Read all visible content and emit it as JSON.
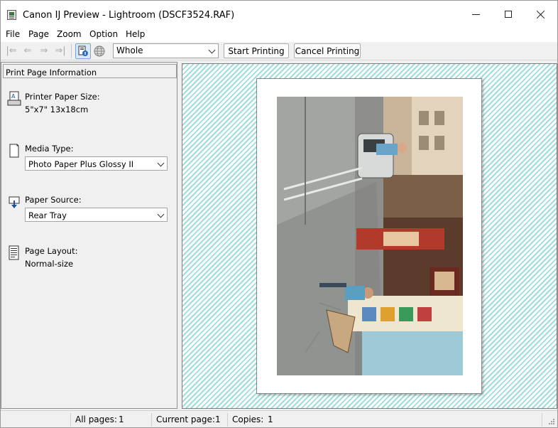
{
  "window": {
    "title": "Canon IJ Preview - Lightroom (DSCF3524.RAF)",
    "icon": "printer-app-icon"
  },
  "menu": {
    "items": [
      "File",
      "Page",
      "Zoom",
      "Option",
      "Help"
    ]
  },
  "toolbar": {
    "nav_icons": [
      "first-page-icon",
      "previous-page-icon",
      "next-page-icon",
      "last-page-icon"
    ],
    "zoom_value": "Whole",
    "start_printing": "Start Printing",
    "cancel_printing": "Cancel Printing"
  },
  "panel": {
    "header": "Print Page Information",
    "paper_size_label": "Printer Paper Size:",
    "paper_size_value": "5\"x7\" 13x18cm",
    "media_type_label": "Media Type:",
    "media_type_value": "Photo Paper Plus Glossy II",
    "paper_source_label": "Paper Source:",
    "paper_source_value": "Rear Tray",
    "page_layout_label": "Page Layout:",
    "page_layout_value": "Normal-size"
  },
  "status": {
    "all_pages_label": "All pages:",
    "all_pages_value": "1",
    "current_page_label": "Current page:",
    "current_page_value": "1",
    "copies_label": "Copies:",
    "copies_value": "1"
  },
  "colors": {
    "preview_stripe": "#9fdcdc",
    "toolbar_bg": "#f0f0f0",
    "active_button": "#d9e8f7"
  }
}
